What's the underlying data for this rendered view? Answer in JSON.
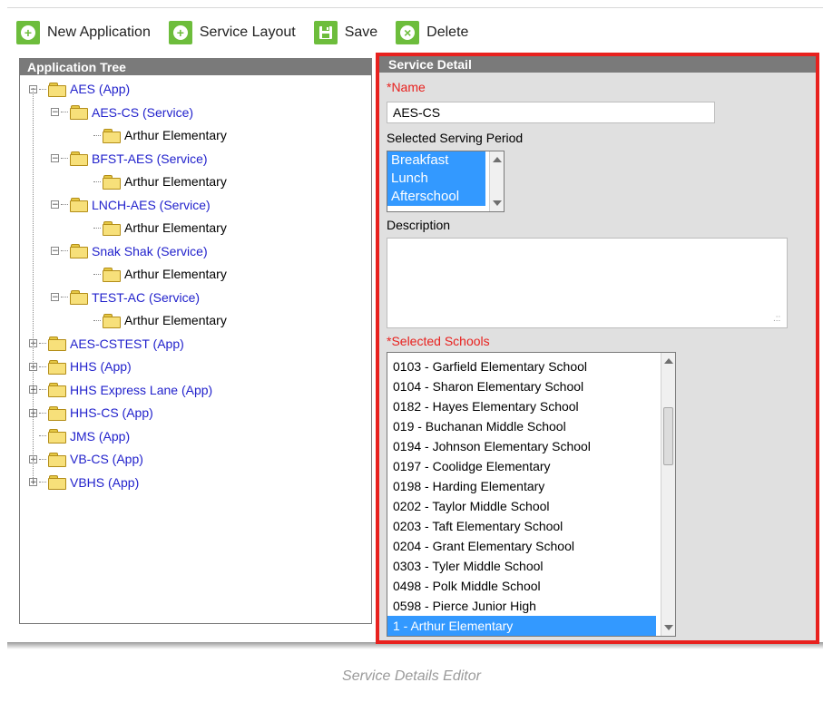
{
  "toolbar": {
    "new_application": "New Application",
    "service_layout": "Service Layout",
    "save": "Save",
    "delete": "Delete"
  },
  "tree": {
    "header": "Application Tree",
    "nodes": [
      {
        "label": "AES (App)",
        "kind": "app",
        "expander": "−"
      },
      {
        "label": "AES-CS (Service)",
        "kind": "svc",
        "expander": "−"
      },
      {
        "label": "Arthur Elementary",
        "kind": "school"
      },
      {
        "label": "BFST-AES (Service)",
        "kind": "svc",
        "expander": "−"
      },
      {
        "label": "Arthur Elementary",
        "kind": "school"
      },
      {
        "label": "LNCH-AES (Service)",
        "kind": "svc",
        "expander": "−"
      },
      {
        "label": "Arthur Elementary",
        "kind": "school"
      },
      {
        "label": "Snak Shak (Service)",
        "kind": "svc",
        "expander": "−"
      },
      {
        "label": "Arthur Elementary",
        "kind": "school"
      },
      {
        "label": "TEST-AC (Service)",
        "kind": "svc",
        "expander": "−"
      },
      {
        "label": "Arthur Elementary",
        "kind": "school"
      },
      {
        "label": "AES-CSTEST (App)",
        "kind": "app",
        "expander": "+"
      },
      {
        "label": "HHS (App)",
        "kind": "app",
        "expander": "+"
      },
      {
        "label": "HHS Express Lane (App)",
        "kind": "app",
        "expander": "+"
      },
      {
        "label": "HHS-CS (App)",
        "kind": "app",
        "expander": "+"
      },
      {
        "label": "JMS (App)",
        "kind": "app"
      },
      {
        "label": "VB-CS (App)",
        "kind": "app",
        "expander": "+"
      },
      {
        "label": "VBHS (App)",
        "kind": "app",
        "expander": "+"
      }
    ]
  },
  "detail": {
    "header": "Service Detail",
    "name_label": "*Name",
    "name_value": "AES-CS",
    "period_label": "Selected Serving Period",
    "periods": [
      "Breakfast",
      "Lunch",
      "Afterschool"
    ],
    "description_label": "Description",
    "description_value": "",
    "schools_label": "*Selected Schools",
    "schools": [
      {
        "label": "0103 - Garfield Elementary School",
        "selected": false
      },
      {
        "label": "0104 - Sharon Elementary School",
        "selected": false
      },
      {
        "label": "0182 - Hayes Elementary School",
        "selected": false
      },
      {
        "label": "019 - Buchanan Middle School",
        "selected": false
      },
      {
        "label": "0194 - Johnson Elementary School",
        "selected": false
      },
      {
        "label": "0197 - Coolidge Elementary",
        "selected": false
      },
      {
        "label": "0198 - Harding Elementary",
        "selected": false
      },
      {
        "label": "0202 - Taylor Middle School",
        "selected": false
      },
      {
        "label": "0203 - Taft Elementary School",
        "selected": false
      },
      {
        "label": "0204 - Grant Elementary School",
        "selected": false
      },
      {
        "label": "0303 - Tyler Middle School",
        "selected": false
      },
      {
        "label": "0498 - Polk Middle School",
        "selected": false
      },
      {
        "label": "0598 - Pierce Junior High",
        "selected": false
      },
      {
        "label": "1 - Arthur Elementary",
        "selected": true
      }
    ]
  },
  "caption": "Service Details Editor",
  "colors": {
    "highlight_border": "#e8211e",
    "toolbar_icon": "#6dbd3c",
    "selection": "#3399ff",
    "tree_link": "#2222cc"
  },
  "icons": {
    "new_application": "plus-circle-icon",
    "service_layout": "plus-circle-icon",
    "save": "floppy-disk-icon",
    "delete": "x-circle-icon",
    "tree_node": "folder-icon"
  }
}
